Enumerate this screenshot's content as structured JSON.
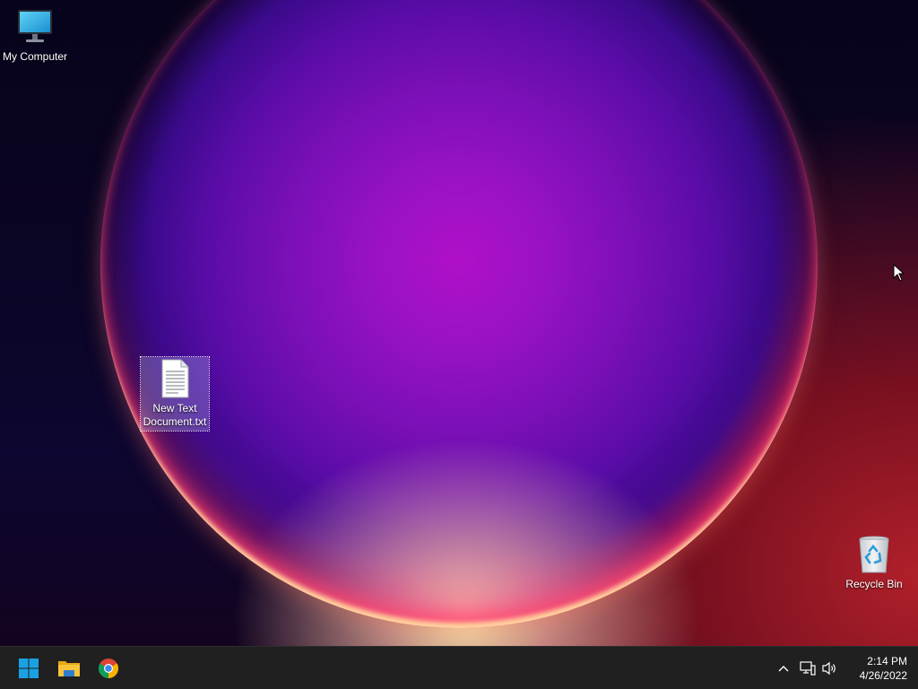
{
  "desktop": {
    "icons": [
      {
        "label": "My Computer",
        "icon": "monitor-icon"
      },
      {
        "label": "New Text Document.txt",
        "icon": "text-file-icon",
        "selected": true
      },
      {
        "label": "Recycle Bin",
        "icon": "recycle-bin-icon"
      }
    ]
  },
  "taskbar": {
    "pinned": [
      {
        "name": "Start",
        "icon": "windows-logo-icon"
      },
      {
        "name": "File Explorer",
        "icon": "folder-icon"
      },
      {
        "name": "Google Chrome",
        "icon": "chrome-icon"
      }
    ],
    "tray": {
      "overflow_icon": "chevron-up-icon",
      "network_icon": "network-icon",
      "volume_icon": "speaker-icon"
    },
    "clock": {
      "time": "2:14 PM",
      "date": "4/26/2022"
    }
  },
  "colors": {
    "taskbar_bg": "#202020",
    "accent_blue": "#1ba1e2",
    "folder_yellow": "#f8c53a"
  }
}
